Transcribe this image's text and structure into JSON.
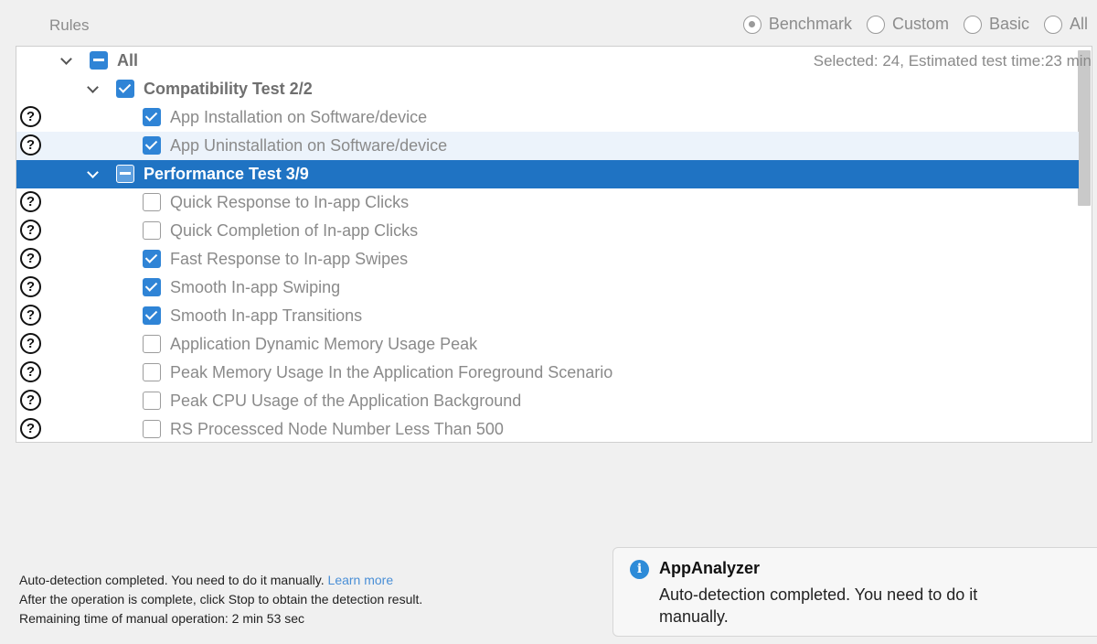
{
  "rules_label": "Rules",
  "radios": [
    {
      "label": "Benchmark",
      "selected": true
    },
    {
      "label": "Custom",
      "selected": false
    },
    {
      "label": "Basic",
      "selected": false
    },
    {
      "label": "All",
      "selected": false
    }
  ],
  "tree": {
    "estimate": "Selected: 24, Estimated test time:23 min",
    "rows": [
      {
        "label": "All",
        "level": 0,
        "type": "group",
        "state": "partial",
        "help": false,
        "expanded": true
      },
      {
        "label": "Compatibility Test 2/2",
        "level": 1,
        "type": "group",
        "state": "checked",
        "help": false,
        "expanded": true
      },
      {
        "label": "App Installation on Software/device",
        "level": 2,
        "type": "item",
        "state": "checked",
        "help": true
      },
      {
        "label": "App Uninstallation on Software/device",
        "level": 2,
        "type": "item",
        "state": "checked",
        "help": true,
        "hover": true
      },
      {
        "label": "Performance Test 3/9",
        "level": 1,
        "type": "group",
        "state": "partial",
        "help": false,
        "expanded": true,
        "selected": true
      },
      {
        "label": "Quick Response to In-app Clicks",
        "level": 2,
        "type": "item",
        "state": "unchecked",
        "help": true
      },
      {
        "label": "Quick Completion of In-app Clicks",
        "level": 2,
        "type": "item",
        "state": "unchecked",
        "help": true
      },
      {
        "label": "Fast Response to In-app Swipes",
        "level": 2,
        "type": "item",
        "state": "checked",
        "help": true
      },
      {
        "label": "Smooth In-app Swiping",
        "level": 2,
        "type": "item",
        "state": "checked",
        "help": true
      },
      {
        "label": "Smooth In-app Transitions",
        "level": 2,
        "type": "item",
        "state": "checked",
        "help": true
      },
      {
        "label": "Application Dynamic Memory Usage Peak",
        "level": 2,
        "type": "item",
        "state": "unchecked",
        "help": true
      },
      {
        "label": "Peak Memory Usage In the Application Foreground Scenario",
        "level": 2,
        "type": "item",
        "state": "unchecked",
        "help": true
      },
      {
        "label": "Peak CPU Usage of the Application Background",
        "level": 2,
        "type": "item",
        "state": "unchecked",
        "help": true
      },
      {
        "label": "RS Processced Node Number Less Than 500",
        "level": 2,
        "type": "item",
        "state": "unchecked",
        "help": true
      }
    ]
  },
  "bottom": {
    "line1": "Auto-detection completed. You need to do it manually.",
    "learn_more": "Learn more",
    "line2": "After the operation is complete, click Stop to obtain the detection result.",
    "line3": "Remaining time of manual operation: 2 min 53 sec"
  },
  "toast": {
    "icon": "info-icon",
    "title": "AppAnalyzer",
    "message": "Auto-detection completed. You need to do it manually."
  },
  "colors": {
    "accent": "#1f73c3",
    "checkbox": "#2f84d6",
    "link": "#4a8fd6"
  }
}
